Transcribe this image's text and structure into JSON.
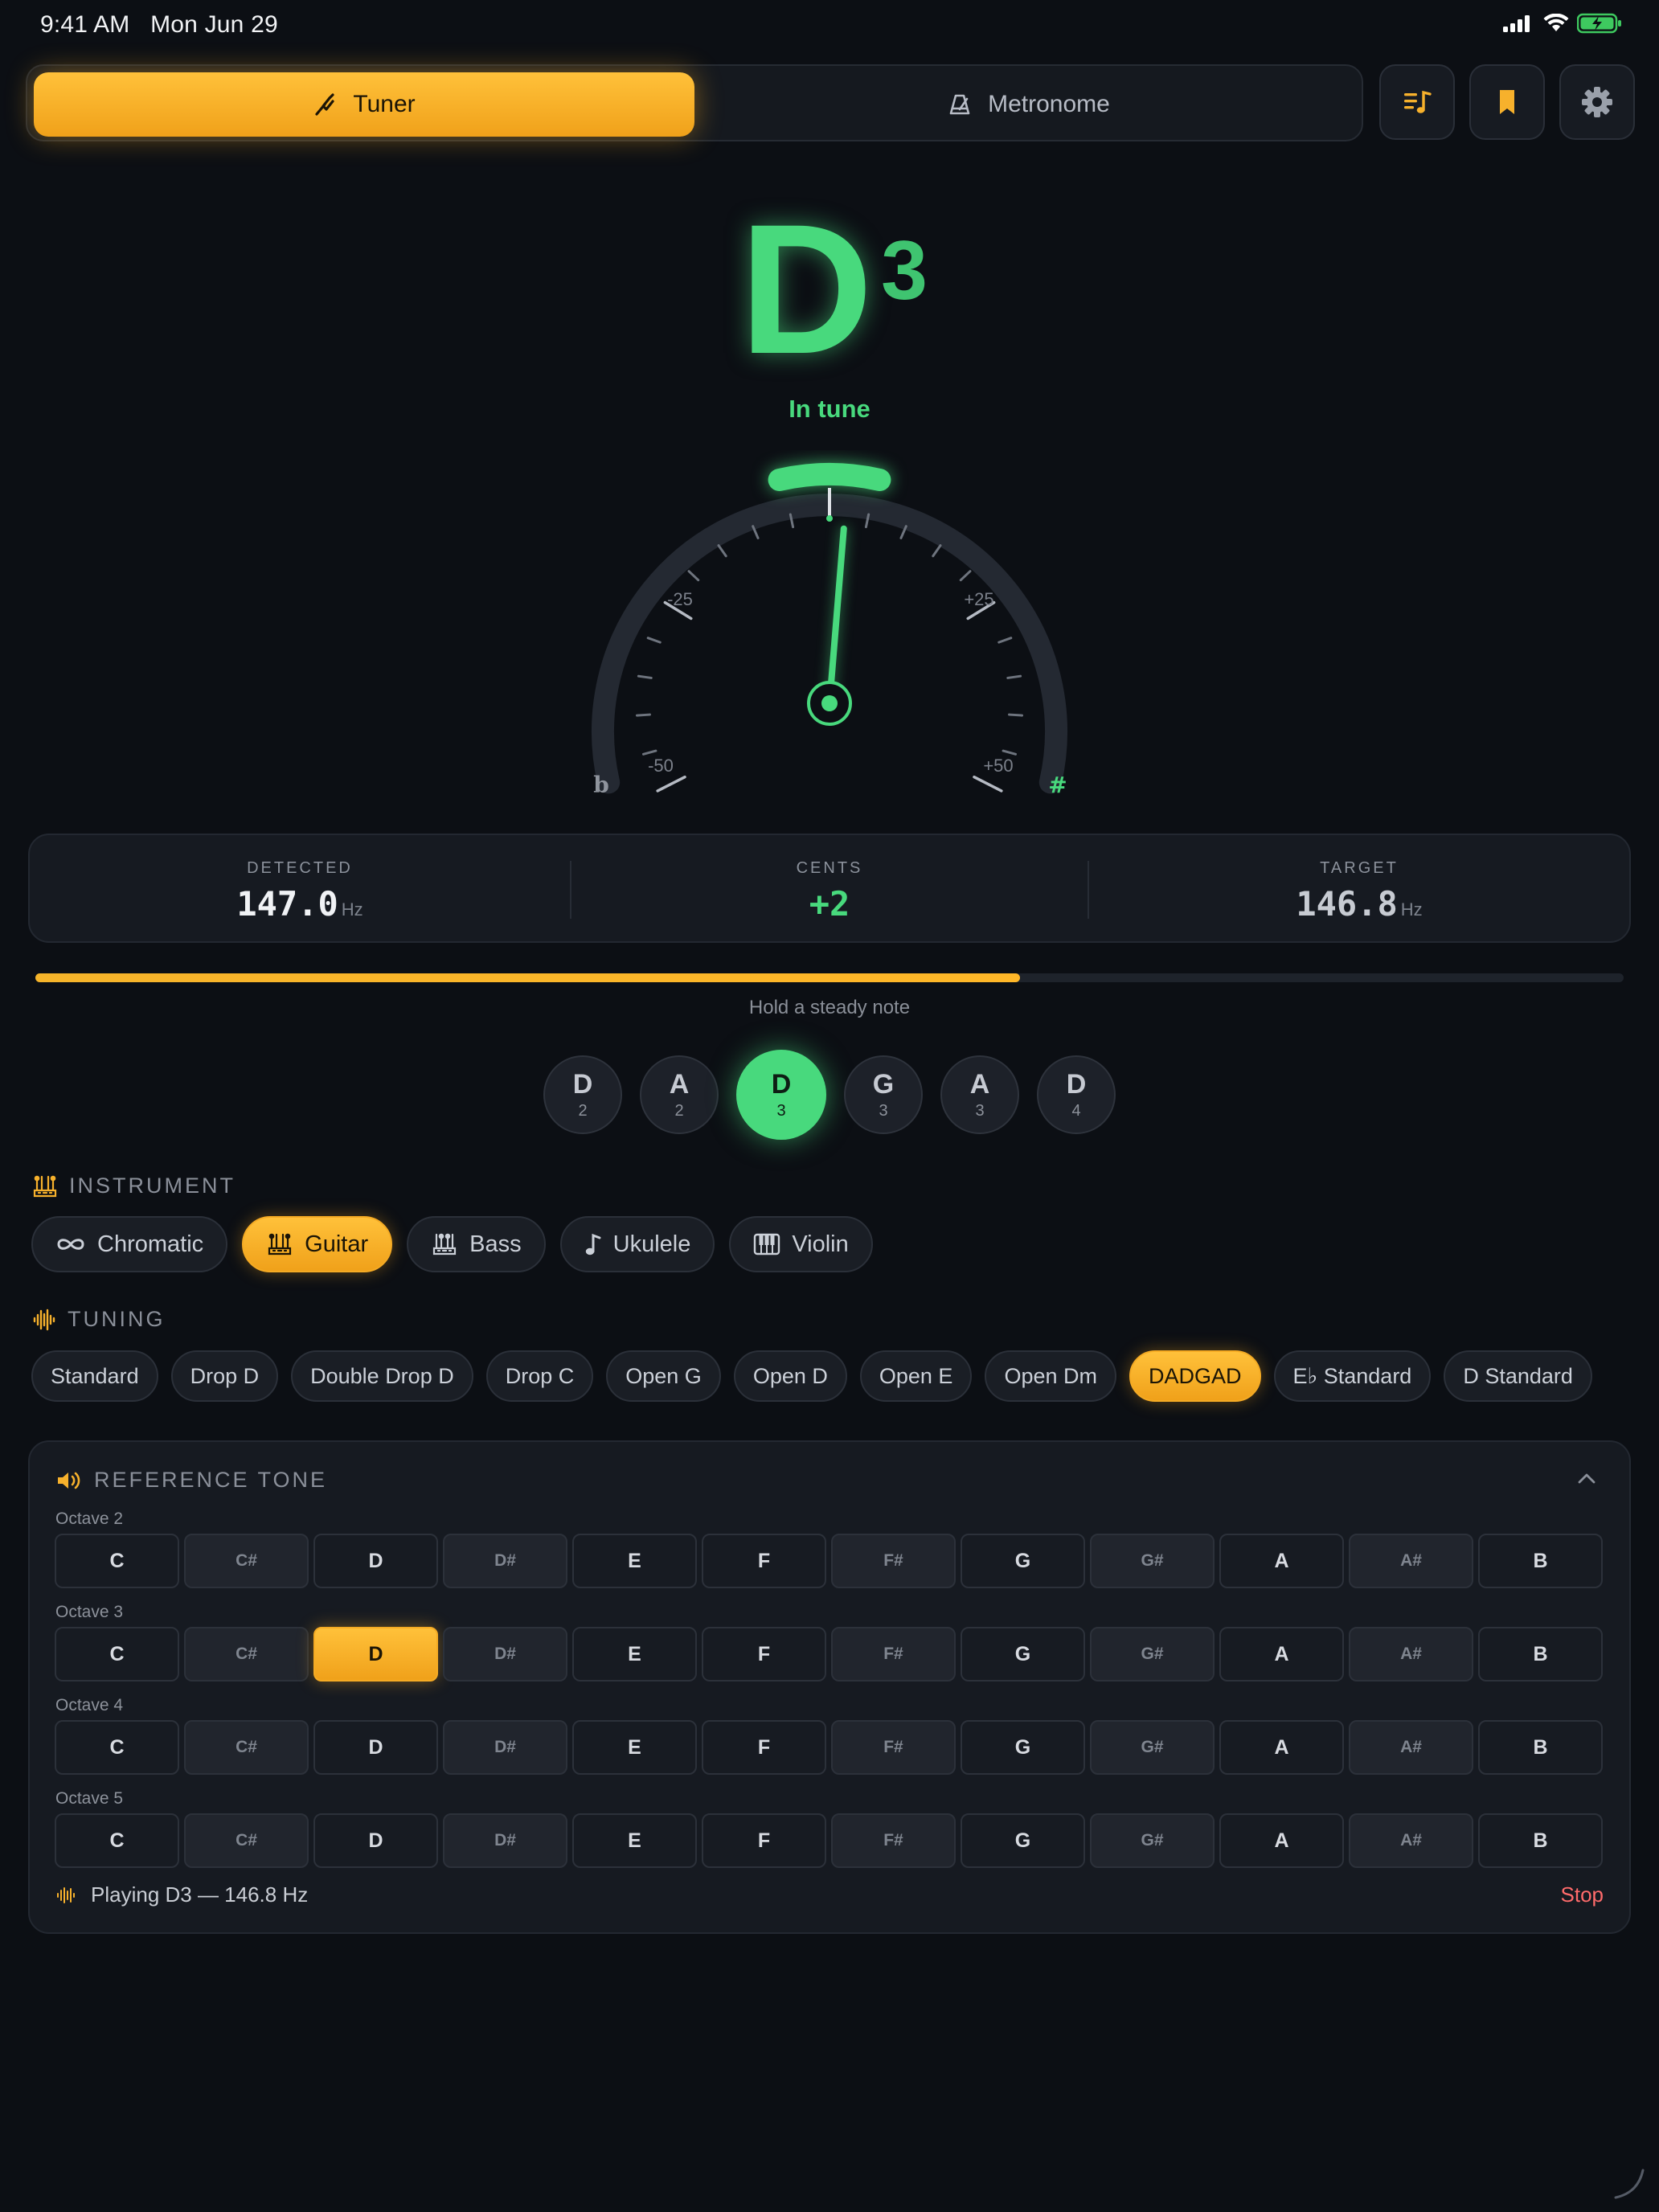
{
  "status_bar": {
    "time": "9:41 AM",
    "date": "Mon Jun 29"
  },
  "mode_switch": {
    "tuner_label": "Tuner",
    "metronome_label": "Metronome",
    "tuner_icon": "tuning-fork-icon",
    "metronome_icon": "metronome-icon"
  },
  "toolbar_icons": [
    "music-list-icon",
    "bookmark-icon",
    "gear-icon"
  ],
  "note": {
    "letter": "D",
    "octave": "3"
  },
  "tune_status": "In tune",
  "gauge": {
    "cents": 2,
    "range": [
      -50,
      50
    ],
    "labels": [
      "-25",
      "+25",
      "-50",
      "+50"
    ],
    "flat_symbol": "b",
    "sharp_symbol": "#"
  },
  "readout": {
    "detected_label": "DETECTED",
    "detected_value": "147.0",
    "cents_label": "CENTS",
    "cents_value": "+2",
    "target_label": "TARGET",
    "target_value": "146.8",
    "unit": "Hz"
  },
  "stability": {
    "progress": 0.62,
    "hint": "Hold a steady note"
  },
  "strings": [
    {
      "note": "D",
      "octave": "2"
    },
    {
      "note": "A",
      "octave": "2"
    },
    {
      "note": "D",
      "octave": "3",
      "active": true
    },
    {
      "note": "G",
      "octave": "3"
    },
    {
      "note": "A",
      "octave": "3"
    },
    {
      "note": "D",
      "octave": "4"
    }
  ],
  "instrument": {
    "heading": "INSTRUMENT",
    "options": [
      {
        "label": "Chromatic",
        "icon": "infinity-icon"
      },
      {
        "label": "Guitar",
        "icon": "guitar-headstock-icon",
        "active": true
      },
      {
        "label": "Bass",
        "icon": "bass-headstock-icon"
      },
      {
        "label": "Ukulele",
        "icon": "music-note-icon"
      },
      {
        "label": "Violin",
        "icon": "piano-keys-icon"
      }
    ]
  },
  "tuning": {
    "heading": "TUNING",
    "options": [
      "Standard",
      "Drop D",
      "Double Drop D",
      "Drop C",
      "Open G",
      "Open D",
      "Open E",
      "Open Dm",
      "DADGAD",
      "E♭ Standard",
      "D Standard"
    ],
    "active": "DADGAD"
  },
  "reference_tone": {
    "heading": "REFERENCE TONE",
    "octaves": [
      {
        "label": "Octave 2",
        "notes": [
          "C",
          "C#",
          "D",
          "D#",
          "E",
          "F",
          "F#",
          "G",
          "G#",
          "A",
          "A#",
          "B"
        ]
      },
      {
        "label": "Octave 3",
        "notes": [
          "C",
          "C#",
          "D",
          "D#",
          "E",
          "F",
          "F#",
          "G",
          "G#",
          "A",
          "A#",
          "B"
        ],
        "selected": "D"
      },
      {
        "label": "Octave 4",
        "notes": [
          "C",
          "C#",
          "D",
          "D#",
          "E",
          "F",
          "F#",
          "G",
          "G#",
          "A",
          "A#",
          "B"
        ]
      },
      {
        "label": "Octave 5",
        "notes": [
          "C",
          "C#",
          "D",
          "D#",
          "E",
          "F",
          "F#",
          "G",
          "G#",
          "A",
          "A#",
          "B"
        ]
      }
    ],
    "playing_text": "Playing D3 — 146.8 Hz",
    "stop_label": "Stop"
  },
  "colors": {
    "accent": "#f7b12c",
    "in_tune": "#48d97d",
    "background": "#0c0f14",
    "stop": "#ff6b6b"
  }
}
